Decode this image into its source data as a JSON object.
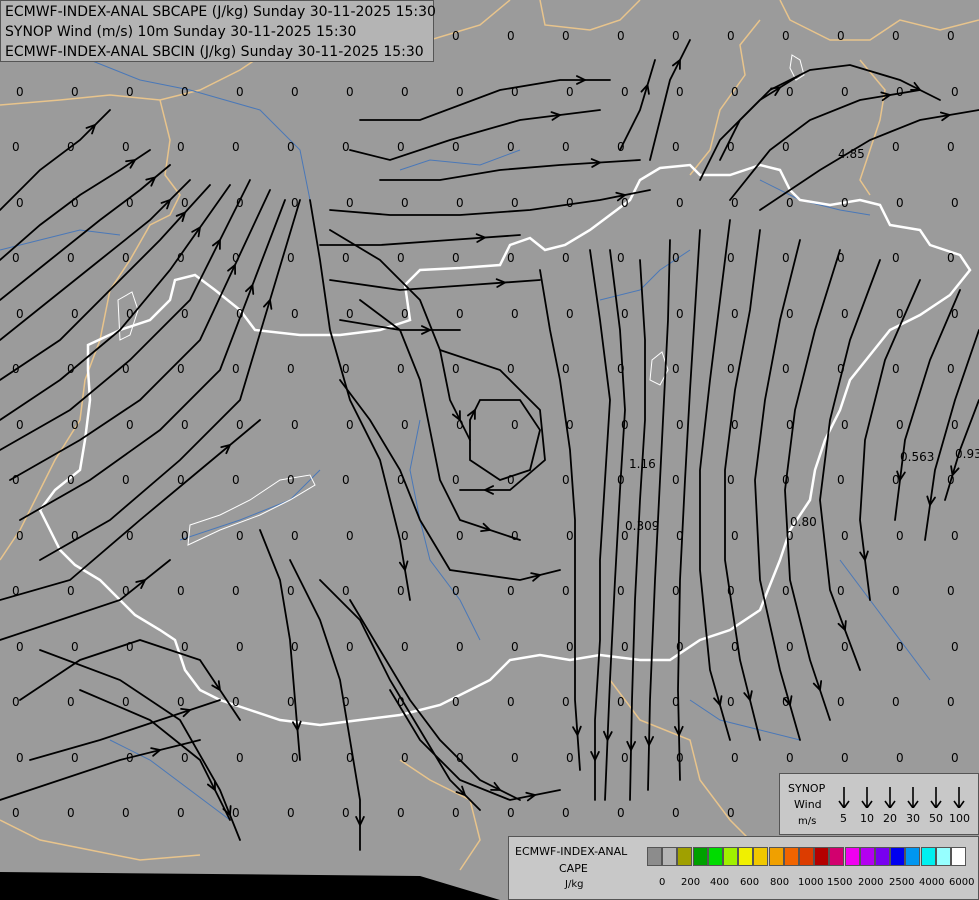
{
  "titles": [
    "ECMWF-INDEX-ANAL SBCAPE (J/kg) Sunday 30-11-2025 15:30",
    "SYNOP Wind (m/s) 10m Sunday 30-11-2025 15:30",
    "ECMWF-INDEX-ANAL SBCIN (J/kg) Sunday 30-11-2025 15:30"
  ],
  "wind_legend": {
    "title_line1": "SYNOP",
    "title_line2": "Wind",
    "title_line3": "m/s",
    "speeds": [
      "5",
      "10",
      "20",
      "30",
      "50",
      "100"
    ]
  },
  "cape_legend": {
    "title_line1": "ECMWF-INDEX-ANAL",
    "title_line2": "CAPE",
    "unit": "J/kg",
    "ticks": [
      "0",
      "200",
      "400",
      "600",
      "800",
      "1000",
      "1500",
      "2000",
      "2500",
      "4000",
      "6000"
    ],
    "colors": [
      "#8c8c8c",
      "#b4b4b4",
      "#a0a000",
      "#00a000",
      "#00dc00",
      "#a0f000",
      "#f0f000",
      "#f0c800",
      "#f0a000",
      "#f06400",
      "#dc3c00",
      "#b40000",
      "#d2006e",
      "#f000f0",
      "#b400f0",
      "#7800f0",
      "#0000f0",
      "#0096f0",
      "#00f0f0",
      "#96ffff",
      "#ffffff"
    ]
  },
  "value_labels": {
    "v485": "4.85",
    "v116": "1.16",
    "v0309": "0.309",
    "v080": "0.80",
    "v0563": "0.563",
    "v093": "0.93"
  },
  "zeros": "0",
  "colors": {
    "background": "#9b9b9b",
    "border_country": "#ffffff",
    "border_region": "#e8c48c",
    "river": "#4a78b8",
    "streamline": "#000000"
  }
}
